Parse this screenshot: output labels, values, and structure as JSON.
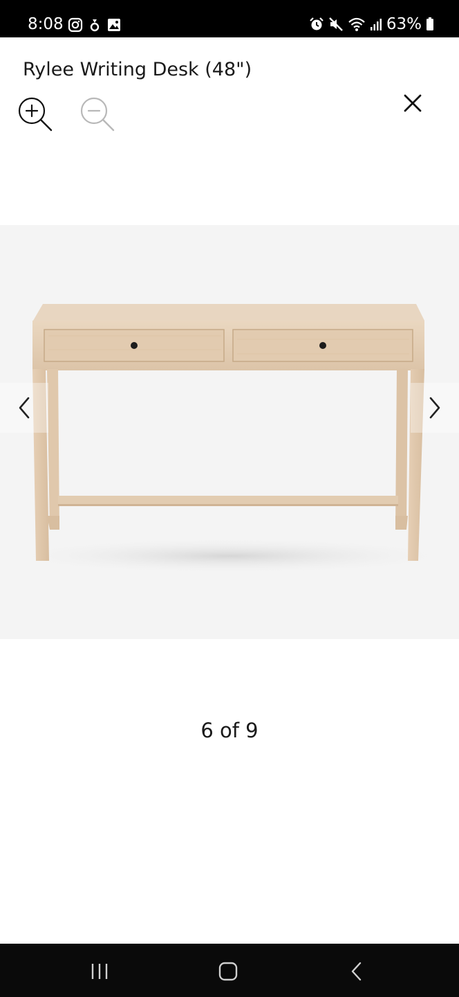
{
  "status_bar": {
    "time": "8:08",
    "battery": "63%",
    "left_icons": [
      "instagram-icon",
      "notification-icon",
      "gallery-icon"
    ],
    "right_icons": [
      "alarm-icon",
      "mute-icon",
      "wifi-icon",
      "signal-icon",
      "battery-icon"
    ]
  },
  "viewer": {
    "title": "Rylee Writing Desk (48\")",
    "zoom_in_icon": "zoom-in-icon",
    "zoom_out_icon": "zoom-out-icon",
    "close_icon": "close-icon",
    "prev_icon": "chevron-left-icon",
    "next_icon": "chevron-right-icon",
    "counter": "6 of 9",
    "image_subject": "light wood writing desk with two drawers"
  },
  "nav_bar": {
    "icons": [
      "recent-apps-icon",
      "home-icon",
      "back-icon"
    ]
  },
  "colors": {
    "status_bar_bg": "#000000",
    "nav_bar_bg": "#0a0a0a",
    "image_bg": "#f4f4f4",
    "text": "#1a1a1a",
    "wood": "#e3cdb4"
  }
}
